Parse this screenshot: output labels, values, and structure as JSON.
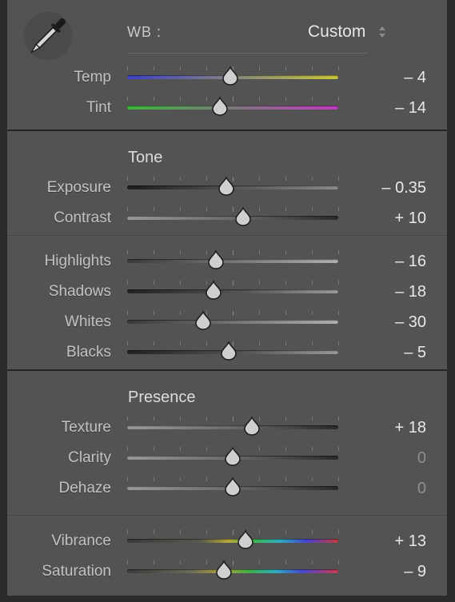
{
  "wb": {
    "label": "WB :",
    "value": "Custom",
    "picker_icon": "eyedropper-icon",
    "selector_icon": "up-down-arrows-icon"
  },
  "colors": {
    "panel_bg": "#535353",
    "temp_gradient": [
      "#4040c8",
      "#c8c83a"
    ],
    "tint_gradient": [
      "#3cb83c",
      "#c03ac0"
    ],
    "vibrance_gradient": [
      "#303030",
      "#4a4a4a",
      "#c9b43a",
      "#3fb84a",
      "#2fb0c0",
      "#4444d0",
      "#c83a3a"
    ]
  },
  "sections": {
    "tone_heading": "Tone",
    "presence_heading": "Presence"
  },
  "sliders": [
    {
      "id": "temp",
      "label": "Temp",
      "value": "– 4",
      "position": 0.49,
      "track": "temp",
      "dim": false
    },
    {
      "id": "tint",
      "label": "Tint",
      "value": "– 14",
      "position": 0.44,
      "track": "tint",
      "dim": false
    },
    {
      "id": "exposure",
      "label": "Exposure",
      "value": "– 0.35",
      "position": 0.47,
      "track": "dark",
      "dim": false
    },
    {
      "id": "contrast",
      "label": "Contrast",
      "value": "+ 10",
      "position": 0.55,
      "track": "dark-right",
      "dim": false
    },
    {
      "id": "highlights",
      "label": "Highlights",
      "value": "– 16",
      "position": 0.42,
      "track": "light",
      "dim": false
    },
    {
      "id": "shadows",
      "label": "Shadows",
      "value": "– 18",
      "position": 0.41,
      "track": "dark-left",
      "dim": false
    },
    {
      "id": "whites",
      "label": "Whites",
      "value": "– 30",
      "position": 0.36,
      "track": "light",
      "dim": false
    },
    {
      "id": "blacks",
      "label": "Blacks",
      "value": "– 5",
      "position": 0.48,
      "track": "dark-left",
      "dim": false
    },
    {
      "id": "texture",
      "label": "Texture",
      "value": "+ 18",
      "position": 0.59,
      "track": "dark-right",
      "dim": false
    },
    {
      "id": "clarity",
      "label": "Clarity",
      "value": "0",
      "position": 0.5,
      "track": "dark-right",
      "dim": true
    },
    {
      "id": "dehaze",
      "label": "Dehaze",
      "value": "0",
      "position": 0.5,
      "track": "dark-right",
      "dim": true
    },
    {
      "id": "vibrance",
      "label": "Vibrance",
      "value": "+ 13",
      "position": 0.56,
      "track": "vibrance",
      "dim": false
    },
    {
      "id": "saturation",
      "label": "Saturation",
      "value": "– 9",
      "position": 0.46,
      "track": "saturation",
      "dim": false
    }
  ]
}
